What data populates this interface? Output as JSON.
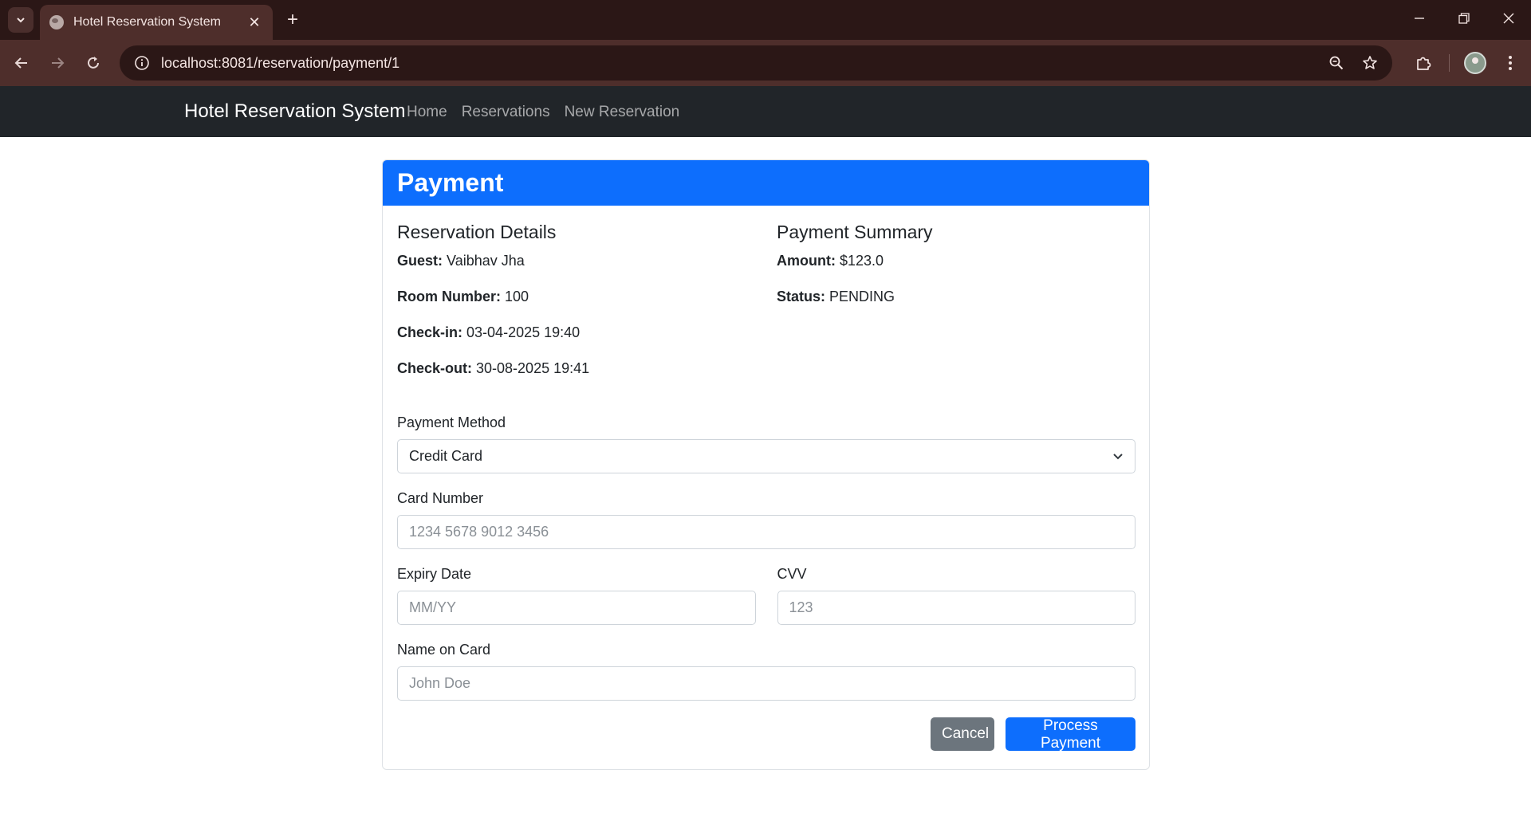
{
  "browser": {
    "tab_title": "Hotel Reservation System",
    "url": "localhost:8081/reservation/payment/1"
  },
  "navbar": {
    "brand": "Hotel Reservation System",
    "links": [
      "Home",
      "Reservations",
      "New Reservation"
    ]
  },
  "card": {
    "title": "Payment",
    "reservation": {
      "heading": "Reservation Details",
      "guest_label": "Guest:",
      "guest": "Vaibhav Jha",
      "room_label": "Room Number:",
      "room": "100",
      "checkin_label": "Check-in:",
      "checkin": "03-04-2025 19:40",
      "checkout_label": "Check-out:",
      "checkout": "30-08-2025 19:41"
    },
    "summary": {
      "heading": "Payment Summary",
      "amount_label": "Amount:",
      "amount": "$123.0",
      "status_label": "Status:",
      "status": "PENDING"
    },
    "form": {
      "method_label": "Payment Method",
      "method_value": "Credit Card",
      "card_number_label": "Card Number",
      "card_number_placeholder": "1234 5678 9012 3456",
      "expiry_label": "Expiry Date",
      "expiry_placeholder": "MM/YY",
      "cvv_label": "CVV",
      "cvv_placeholder": "123",
      "name_label": "Name on Card",
      "name_placeholder": "John Doe",
      "cancel_label": "Cancel",
      "submit_label": "Process Payment"
    }
  }
}
